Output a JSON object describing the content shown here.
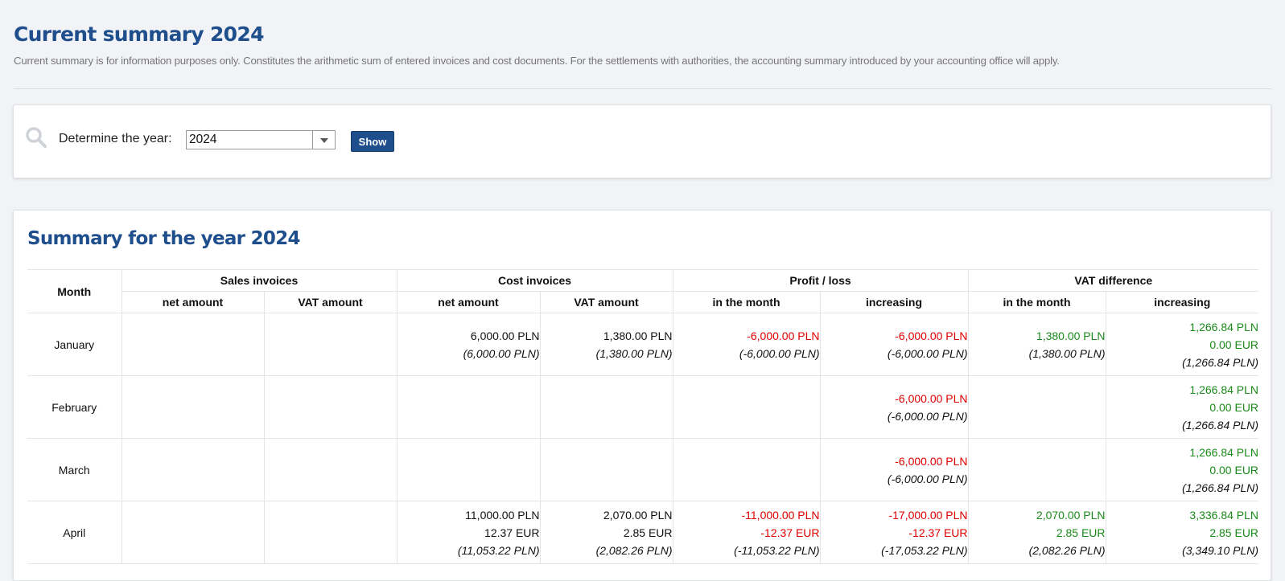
{
  "page": {
    "title": "Current summary 2024",
    "description": "Current summary is for information purposes only. Constitutes the arithmetic sum of entered invoices and cost documents. For the settlements with authorities, the accounting summary introduced by your accounting office will apply."
  },
  "filter": {
    "icon": "search-icon",
    "year_label": "Determine the year:",
    "year_value": "2024",
    "show_label": "Show"
  },
  "summary": {
    "title": "Summary for the year 2024",
    "headers": {
      "month": "Month",
      "sales": "Sales invoices",
      "cost": "Cost invoices",
      "profit": "Profit / loss",
      "vat": "VAT difference",
      "net_amount": "net amount",
      "vat_amount": "VAT amount",
      "in_month": "in the month",
      "increasing": "increasing"
    },
    "rows": [
      {
        "month": "January",
        "sales_net": [],
        "sales_vat": [],
        "cost_net": [
          "6,000.00 PLN",
          "(6,000.00 PLN)"
        ],
        "cost_vat": [
          "1,380.00 PLN",
          "(1,380.00 PLN)"
        ],
        "profit_month": [
          "-6,000.00 PLN",
          "(-6,000.00 PLN)"
        ],
        "profit_inc": [
          "-6,000.00 PLN",
          "(-6,000.00 PLN)"
        ],
        "vat_month": [
          "1,380.00 PLN",
          "(1,380.00 PLN)"
        ],
        "vat_inc": [
          "1,266.84 PLN",
          "0.00 EUR",
          "(1,266.84 PLN)"
        ]
      },
      {
        "month": "February",
        "sales_net": [],
        "sales_vat": [],
        "cost_net": [],
        "cost_vat": [],
        "profit_month": [],
        "profit_inc": [
          "-6,000.00 PLN",
          "(-6,000.00 PLN)"
        ],
        "vat_month": [],
        "vat_inc": [
          "1,266.84 PLN",
          "0.00 EUR",
          "(1,266.84 PLN)"
        ]
      },
      {
        "month": "March",
        "sales_net": [],
        "sales_vat": [],
        "cost_net": [],
        "cost_vat": [],
        "profit_month": [],
        "profit_inc": [
          "-6,000.00 PLN",
          "(-6,000.00 PLN)"
        ],
        "vat_month": [],
        "vat_inc": [
          "1,266.84 PLN",
          "0.00 EUR",
          "(1,266.84 PLN)"
        ]
      },
      {
        "month": "April",
        "sales_net": [],
        "sales_vat": [],
        "cost_net": [
          "11,000.00 PLN",
          "12.37 EUR",
          "(11,053.22 PLN)"
        ],
        "cost_vat": [
          "2,070.00 PLN",
          "2.85 EUR",
          "(2,082.26 PLN)"
        ],
        "profit_month": [
          "-11,000.00 PLN",
          "-12.37 EUR",
          "(-11,053.22 PLN)"
        ],
        "profit_inc": [
          "-17,000.00 PLN",
          "-12.37 EUR",
          "(-17,053.22 PLN)"
        ],
        "vat_month": [
          "2,070.00 PLN",
          "2.85 EUR",
          "(2,082.26 PLN)"
        ],
        "vat_inc": [
          "3,336.84 PLN",
          "2.85 EUR",
          "(3,349.10 PLN)"
        ]
      }
    ]
  },
  "colors": {
    "accent": "#1f4e8c",
    "positive": "#1a8a1a",
    "negative": "#e00000",
    "background": "#f1f3f6"
  }
}
